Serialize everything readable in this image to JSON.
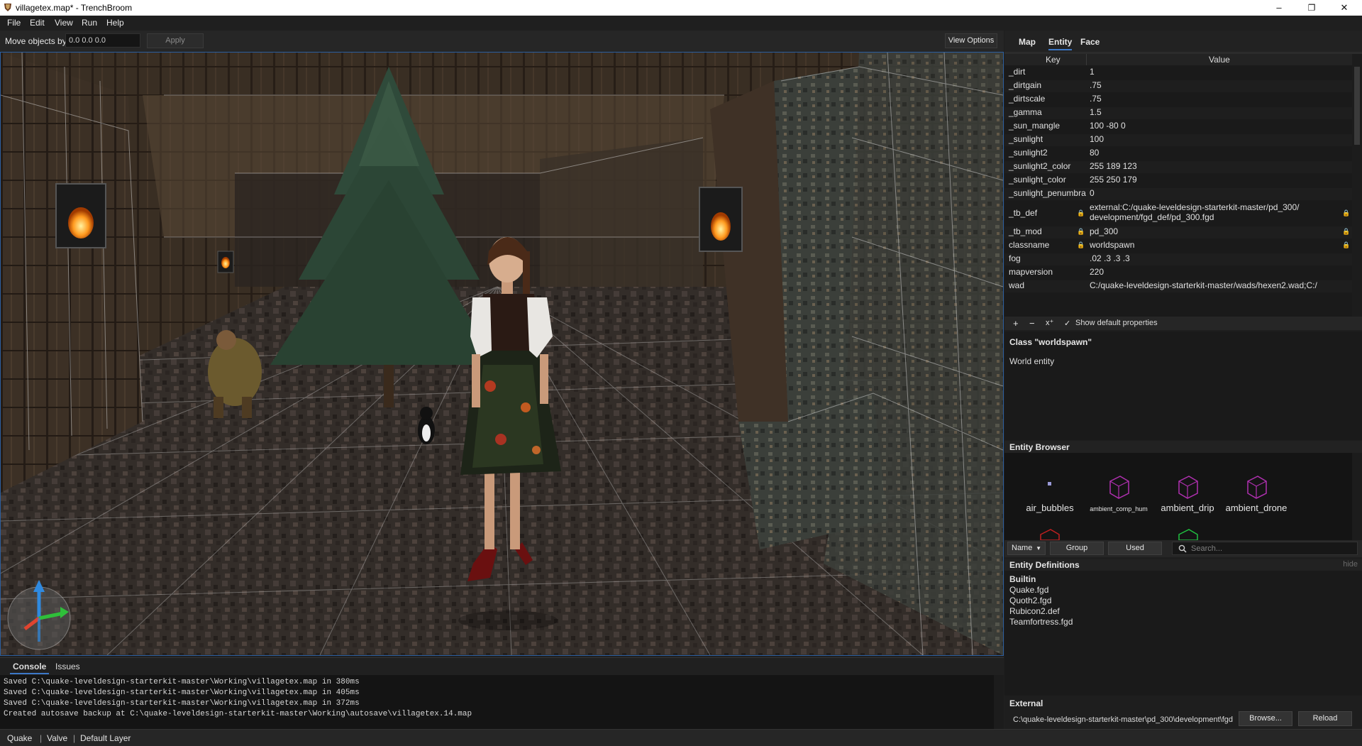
{
  "window": {
    "title": "villagetex.map* - TrenchBroom",
    "controls": {
      "minimize": "–",
      "maximize": "❐",
      "close": "✕"
    }
  },
  "menu": [
    "File",
    "Edit",
    "View",
    "Run",
    "Help"
  ],
  "toolbar": {
    "move_label": "Move objects by",
    "move_value": "0.0 0.0 0.0",
    "apply": "Apply",
    "view_options": "View Options"
  },
  "viewport": {
    "scene": "3D textured Quake village courtyard with brush wireframe overlay, pine tree, lanterns, a woman in a dress, a small cat and a monster in the background",
    "colors": {
      "wall": "#4a3c2e",
      "floor": "#3e3530",
      "grid": "#cfcfcf",
      "tree": "#2f4a3a"
    }
  },
  "console": {
    "tabs": [
      "Console",
      "Issues"
    ],
    "lines": [
      "Saved C:\\quake-leveldesign-starterkit-master\\Working\\villagetex.map in 380ms",
      "Saved C:\\quake-leveldesign-starterkit-master\\Working\\villagetex.map in 405ms",
      "Saved C:\\quake-leveldesign-starterkit-master\\Working\\villagetex.map in 372ms",
      "Created autosave backup at C:\\quake-leveldesign-starterkit-master\\Working\\autosave\\villagetex.14.map"
    ]
  },
  "statusbar": {
    "game": "Quake",
    "format": "Valve",
    "layer": "Default Layer",
    "sep": "|"
  },
  "inspector": {
    "tabs": [
      "Map",
      "Entity",
      "Face"
    ],
    "active_tab": "Entity",
    "columns": {
      "key": "Key",
      "value": "Value"
    },
    "properties": [
      {
        "key": "_dirt",
        "value": "1"
      },
      {
        "key": "_dirtgain",
        "value": ".75"
      },
      {
        "key": "_dirtscale",
        "value": ".75"
      },
      {
        "key": "_gamma",
        "value": "1.5"
      },
      {
        "key": "_sun_mangle",
        "value": "100 -80 0"
      },
      {
        "key": "_sunlight",
        "value": "100"
      },
      {
        "key": "_sunlight2",
        "value": "80"
      },
      {
        "key": "_sunlight2_color",
        "value": "255 189 123"
      },
      {
        "key": "_sunlight_color",
        "value": "255 250 179"
      },
      {
        "key": "_sunlight_penumbra",
        "value": "0"
      },
      {
        "key": "_tb_def",
        "value": "external:C:/quake-leveldesign-starterkit-master/pd_300/ development/fgd_def/pd_300.fgd",
        "locked": true
      },
      {
        "key": "_tb_mod",
        "value": "pd_300",
        "locked": true
      },
      {
        "key": "classname",
        "value": "worldspawn",
        "locked": true
      },
      {
        "key": "fog",
        "value": ".02 .3 .3 .3"
      },
      {
        "key": "mapversion",
        "value": "220"
      },
      {
        "key": "wad",
        "value": "C:/quake-leveldesign-starterkit-master/wads/hexen2.wad;C:/"
      }
    ],
    "tools": {
      "add": "+",
      "remove": "−",
      "clear": "x⁺",
      "show_default": "Show default properties",
      "checked": "✓"
    },
    "class_title": "Class \"worldspawn\"",
    "class_desc": "World entity"
  },
  "entity_browser": {
    "title": "Entity Browser",
    "entities": [
      "air_bubbles",
      "ambient_comp_hum",
      "ambient_drip",
      "ambient_drone"
    ],
    "sort": "Name",
    "group": "Group",
    "used": "Used",
    "search_placeholder": "Search..."
  },
  "entity_definitions": {
    "title": "Entity Definitions",
    "hide": "hide",
    "items": [
      "Builtin",
      "Quake.fgd",
      "Quoth2.fgd",
      "Rubicon2.def",
      "Teamfortress.fgd"
    ]
  },
  "external": {
    "title": "External",
    "path": "C:\\quake-leveldesign-starterkit-master\\pd_300\\development\\fgd",
    "browse": "Browse...",
    "reload": "Reload"
  },
  "icons": [
    "app-logo-icon",
    "lock-icon",
    "search-icon",
    "axis-gizmo-icon",
    "wireframe-box-icon",
    "sort-dropdown-icon"
  ]
}
